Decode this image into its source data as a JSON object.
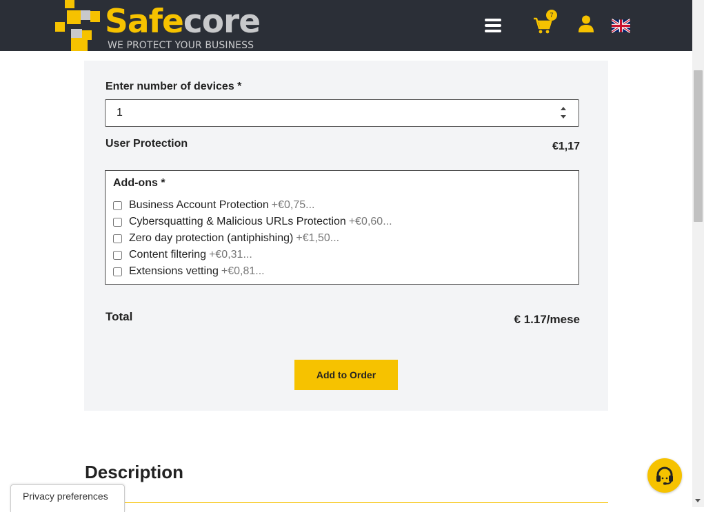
{
  "header": {
    "logo_primary": "Safe",
    "logo_secondary": "core",
    "tagline": "WE PROTECT YOUR BUSINESS",
    "cart_count": "7",
    "colors": {
      "background": "#2b2f37",
      "accent": "#f6c200",
      "logo_grey": "#c8c9cb"
    },
    "icons": [
      "hamburger-menu-icon",
      "cart-icon",
      "user-icon",
      "uk-flag-icon"
    ]
  },
  "form": {
    "devices_label": "Enter number of devices *",
    "devices_value": "1",
    "product_label": "User Protection",
    "product_price": "€1,17",
    "addons_title": "Add-ons *",
    "addons": [
      {
        "name": "Business Account Protection",
        "price": "+€0,75...",
        "checked": false
      },
      {
        "name": "Cybersquatting & Malicious URLs Protection",
        "price": "+€0,60...",
        "checked": false
      },
      {
        "name": "Zero day protection (antiphishing)",
        "price": "+€1,50...",
        "checked": false
      },
      {
        "name": "Content filtering",
        "price": "+€0,31...",
        "checked": false
      },
      {
        "name": "Extensions vetting",
        "price": "+€0,81...",
        "checked": false
      }
    ],
    "total_label": "Total",
    "total_value": "€ 1.17/mese",
    "add_button": "Add to Order"
  },
  "description": {
    "title": "Description"
  },
  "privacy": {
    "label": "Privacy preferences"
  },
  "support": {
    "icon": "headset-icon"
  }
}
